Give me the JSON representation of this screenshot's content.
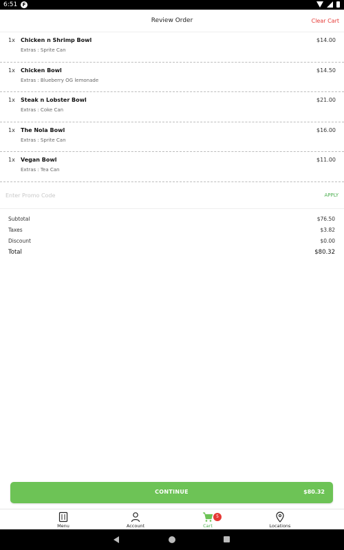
{
  "status_bar": {
    "time": "6:51",
    "app_glyph": "F"
  },
  "header": {
    "title": "Review Order",
    "clear_cart": "Clear Cart"
  },
  "items": [
    {
      "qty": "1x",
      "name": "Chicken n Shrimp Bowl",
      "extras": "Extras : Sprite Can",
      "price": "$14.00"
    },
    {
      "qty": "1x",
      "name": "Chicken Bowl",
      "extras": "Extras : Blueberry OG lemonade",
      "price": "$14.50"
    },
    {
      "qty": "1x",
      "name": "Steak n Lobster Bowl",
      "extras": "Extras : Coke Can",
      "price": "$21.00"
    },
    {
      "qty": "1x",
      "name": "The Nola Bowl",
      "extras": "Extras : Sprite Can",
      "price": "$16.00"
    },
    {
      "qty": "1x",
      "name": "Vegan Bowl",
      "extras": "Extras : Tea Can",
      "price": "$11.00"
    }
  ],
  "promo": {
    "placeholder": "Enter Promo Code",
    "value": "",
    "apply_label": "APPLY"
  },
  "summary": {
    "subtotal_label": "Subtotal",
    "subtotal": "$76.50",
    "taxes_label": "Taxes",
    "taxes": "$3.82",
    "discount_label": "Discount",
    "discount": "$0.00",
    "total_label": "Total",
    "total": "$80.32"
  },
  "continue": {
    "label": "CONTINUE",
    "amount": "$80.32"
  },
  "nav": {
    "menu": "Menu",
    "account": "Account",
    "cart": "Cart",
    "cart_count": "5",
    "locations": "Locations"
  },
  "colors": {
    "accent": "#6dc356",
    "danger": "#e53935"
  },
  "icons": {
    "menu": "menu-book-icon",
    "account": "person-icon",
    "cart": "cart-icon",
    "locations": "location-pin-icon"
  }
}
